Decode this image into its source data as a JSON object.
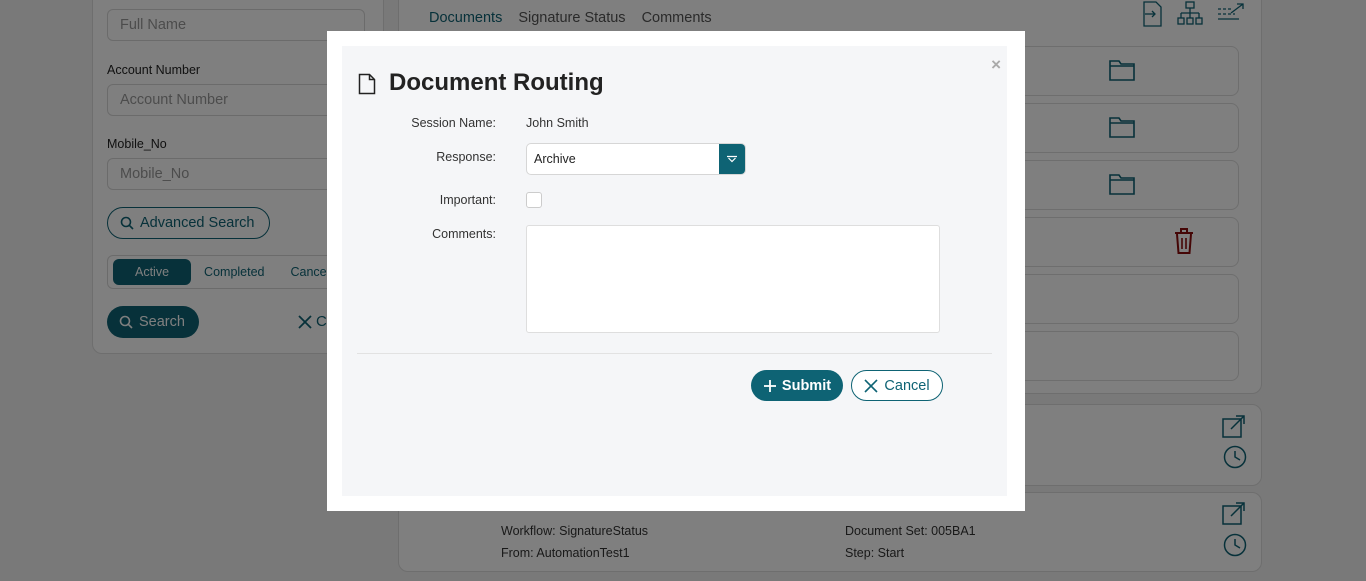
{
  "filters": {
    "full_name_placeholder": "Full Name",
    "account_label": "Account Number",
    "account_placeholder": "Account Number",
    "mobile_label": "Mobile_No",
    "mobile_placeholder": "Mobile_No",
    "advanced_search": "Advanced Search",
    "status_tabs": [
      "Active",
      "Completed",
      "Cance"
    ],
    "search": "Search",
    "clear": "C"
  },
  "documents": {
    "tabs": [
      "Documents",
      "Signature Status",
      "Comments"
    ]
  },
  "card": {
    "workflow": "Workflow: SignatureStatus",
    "from": "From: AutomationTest1",
    "document_set": "Document Set: 005BA1",
    "step": "Step: Start"
  },
  "modal": {
    "title": "Document Routing",
    "close": "×",
    "session_label": "Session Name:",
    "session_value": "John Smith",
    "response_label": "Response:",
    "response_value": "Archive",
    "important_label": "Important:",
    "important_checked": false,
    "comments_label": "Comments:",
    "comments_value": "",
    "submit": "Submit",
    "cancel": "Cancel"
  },
  "colors": {
    "primary": "#0e6374",
    "danger": "#8b0d0d",
    "overlay": "rgba(0,0,0,0.5)"
  },
  "icons": [
    "document-icon",
    "folder-icon",
    "trash-icon",
    "external-link-icon",
    "history-icon",
    "search-icon",
    "close-icon",
    "plus-icon",
    "chevron-down-icon",
    "sign-in-icon",
    "hierarchy-icon",
    "route-icon"
  ]
}
